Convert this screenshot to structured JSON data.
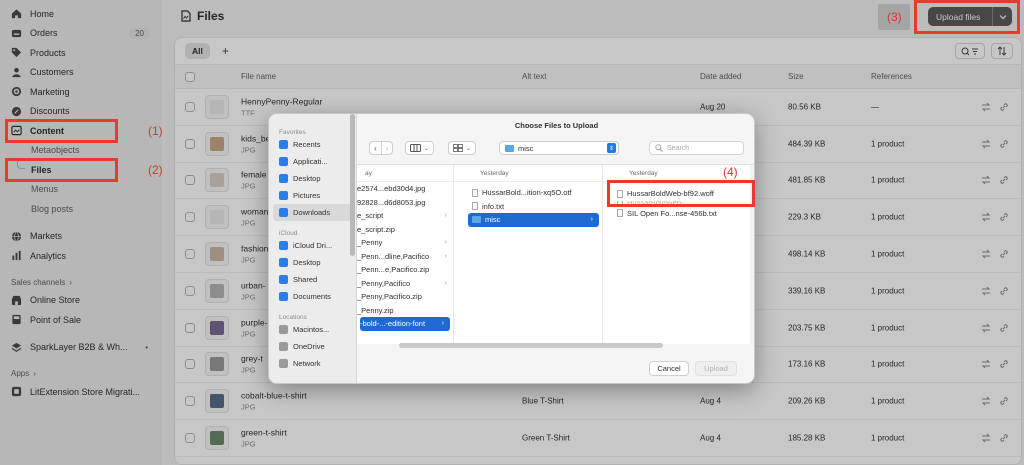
{
  "sidebar": {
    "items": [
      {
        "label": "Home"
      },
      {
        "label": "Orders",
        "badge": "20"
      },
      {
        "label": "Products"
      },
      {
        "label": "Customers"
      },
      {
        "label": "Marketing"
      },
      {
        "label": "Discounts"
      },
      {
        "label": "Content"
      },
      {
        "label": "Metaobjects"
      },
      {
        "label": "Files"
      },
      {
        "label": "Menus"
      },
      {
        "label": "Blog posts"
      },
      {
        "label": "Markets"
      },
      {
        "label": "Analytics"
      }
    ],
    "sales_channels_label": "Sales channels",
    "channels": [
      {
        "label": "Online Store"
      },
      {
        "label": "Point of Sale"
      },
      {
        "label": "SparkLayer B2B & Wh..."
      }
    ],
    "apps_label": "Apps",
    "apps": [
      {
        "label": "LitExtension Store Migrati..."
      }
    ]
  },
  "page": {
    "title": "Files",
    "upload_label": "Upload files",
    "tab_all": "All",
    "tab_add": "+"
  },
  "table": {
    "headers": {
      "name": "File name",
      "alt": "Alt text",
      "date": "Date added",
      "size": "Size",
      "refs": "References"
    },
    "rows": [
      {
        "name": "HennyPenny-Regular",
        "type": "TTF",
        "alt": "",
        "date": "Aug 20",
        "size": "80.56 KB",
        "refs": "—"
      },
      {
        "name": "kids_be",
        "type": "JPG",
        "alt": "",
        "date": "",
        "size": "484.39 KB",
        "refs": "1 product"
      },
      {
        "name": "female",
        "type": "JPG",
        "alt": "",
        "date": "",
        "size": "481.85 KB",
        "refs": "1 product"
      },
      {
        "name": "woman",
        "type": "JPG",
        "alt": "",
        "date": "",
        "size": "229.3 KB",
        "refs": "1 product"
      },
      {
        "name": "fashion",
        "type": "JPG",
        "alt": "",
        "date": "",
        "size": "498.14 KB",
        "refs": "1 product"
      },
      {
        "name": "urban-",
        "type": "JPG",
        "alt": "",
        "date": "",
        "size": "339.16 KB",
        "refs": "1 product"
      },
      {
        "name": "purple-",
        "type": "JPG",
        "alt": "",
        "date": "",
        "size": "203.75 KB",
        "refs": "1 product"
      },
      {
        "name": "grey-t",
        "type": "JPG",
        "alt": "",
        "date": "",
        "size": "173.16 KB",
        "refs": "1 product"
      },
      {
        "name": "cobalt-blue-t-shirt",
        "type": "JPG",
        "alt": "Blue T-Shirt",
        "date": "Aug 4",
        "size": "209.26 KB",
        "refs": "1 product"
      },
      {
        "name": "green-t-shirt",
        "type": "JPG",
        "alt": "Green T-Shirt",
        "date": "Aug 4",
        "size": "185.28 KB",
        "refs": "1 product"
      }
    ]
  },
  "dialog": {
    "title": "Choose Files to Upload",
    "favorites_label": "Favorites",
    "favorites": [
      "Recents",
      "Applicati...",
      "Desktop",
      "Pictures",
      "Downloads"
    ],
    "icloud_label": "iCloud",
    "icloud": [
      "iCloud Dri...",
      "Desktop",
      "Shared",
      "Documents"
    ],
    "locations_label": "Locations",
    "locations": [
      "Macintos...",
      "OneDrive",
      "Network"
    ],
    "path_folder": "misc",
    "search_placeholder": "Search",
    "col1_header": "ay",
    "col1": [
      "e2574...ebd30d4.jpg",
      "92828...d6d8053.jpg",
      "e_script",
      "e_script.zip",
      "_Penny",
      "_Penn...dline,Pacifico",
      "_Penn...e,Pacifico.zip",
      "_Penny,Pacifico",
      "_Penny,Pacifico.zip",
      "_Penny.zip",
      "-bold-...-edition-font"
    ],
    "col2_header": "Yesterday",
    "col2": [
      "HussarBold...ition-xq5O.otf",
      "info.txt",
      "misc"
    ],
    "col3_header": "Yesterday",
    "col3": [
      "HussarBoldWeb-bf92.woff",
      "HussarBoldWeb-...",
      "SIL Open Fo...nse-456b.txt"
    ],
    "cancel_label": "Cancel",
    "upload_label": "Upload"
  },
  "annotations": {
    "step1": "(1)",
    "step2": "(2)",
    "step3": "(3)",
    "step4": "(4)",
    "color": "#e83a2f"
  }
}
